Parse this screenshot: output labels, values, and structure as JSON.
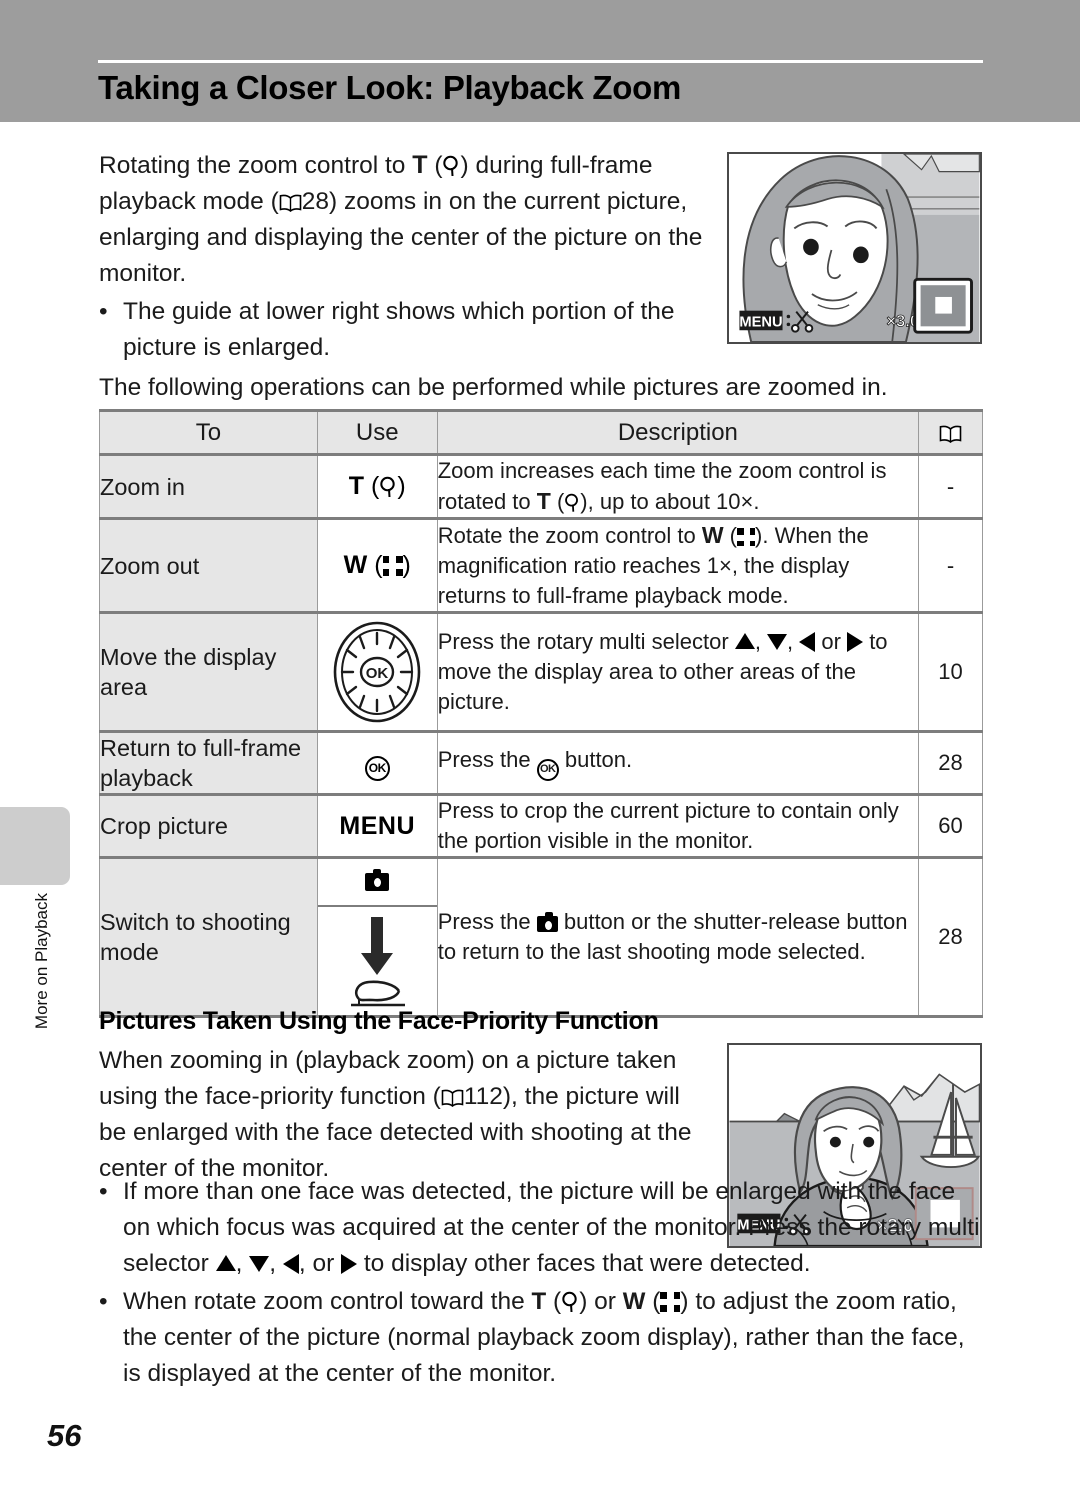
{
  "header": {
    "title": "Taking a Closer Look: Playback Zoom"
  },
  "side_tab": {
    "label": "More on Playback"
  },
  "intro": {
    "para1_a": "Rotating the zoom control to ",
    "para1_T": "T",
    "para1_b": " (",
    "para1_c": ") during full-frame playback mode (",
    "para1_ref": "28",
    "para1_d": ") zooms in on the current picture, enlarging and displaying the center of the picture on the monitor.",
    "bullet1_dot": "•",
    "bullet1": "The guide at lower right shows which portion of the picture is enlarged."
  },
  "following_line": "The following operations can be performed while pictures are zoomed in.",
  "table": {
    "headers": {
      "to": "To",
      "use": "Use",
      "description": "Description",
      "reference": "book-icon"
    },
    "rows": [
      {
        "to": "Zoom in",
        "use_text": "T",
        "use_icon": "magnifier-icon",
        "desc_a": "Zoom increases each time the zoom control is rotated to ",
        "desc_T": "T",
        "desc_b": " (",
        "desc_c": "), up to about 10×.",
        "ref": "-"
      },
      {
        "to": "Zoom out",
        "use_text": "W",
        "use_icon": "thumbnail-icon",
        "desc_a": "Rotate the zoom control to ",
        "desc_W": "W",
        "desc_b": " (",
        "desc_c": "). When the magnification ratio reaches 1×, the display returns to full-frame playback mode.",
        "ref": "-"
      },
      {
        "to": "Move the display area",
        "use_icon": "rotary-multi-selector-icon",
        "desc_a": "Press the rotary multi selector ",
        "desc_b": ", ",
        "desc_c": ", ",
        "desc_d": " or ",
        "desc_e": " to move the display area to other areas of the picture.",
        "ref": "10"
      },
      {
        "to": "Return to full-frame playback",
        "use_icon": "ok-button-icon",
        "use_label": "OK",
        "desc_a": "Press the ",
        "desc_b": " button.",
        "ref": "28"
      },
      {
        "to": "Crop picture",
        "use_text": "MENU",
        "desc_a": "Press to crop the current picture to contain only the portion visible in the monitor.",
        "ref": "60"
      },
      {
        "to": "Switch to shooting mode",
        "use_icon_top": "camera-icon",
        "use_icon_bottom": "shutter-release-icon",
        "desc_a": "Press the ",
        "desc_b": " button or the shutter-release button to return to the last shooting mode selected.",
        "ref": "28"
      }
    ]
  },
  "section2": {
    "heading": "Pictures Taken Using the Face-Priority Function",
    "body_a": "When zooming in (playback zoom) on a picture taken using the face-priority function (",
    "body_ref": "112",
    "body_b": "), the picture will be enlarged with the face detected with shooting at the center of the monitor.",
    "bullet1_dot": "•",
    "bullet1_a": "If more than one face was detected, the picture will be enlarged with the face on which focus was acquired at the center of the monitor. Press the rotary multi selector ",
    "bullet1_b": ", ",
    "bullet1_c": ", ",
    "bullet1_d": ", or ",
    "bullet1_e": " to display other faces that were detected.",
    "bullet2_dot": "•",
    "bullet2_a": "When rotate zoom control toward the ",
    "bullet2_T": "T",
    "bullet2_b": " (",
    "bullet2_c": ") or ",
    "bullet2_W": "W",
    "bullet2_d": " (",
    "bullet2_e": ") to adjust the zoom ratio, the center of the picture (normal playback zoom display), rather than the face, is displayed at the center of the monitor."
  },
  "monitor1": {
    "menu_label": "MENU",
    "crop_icon": "scissors-icon",
    "magnification": "×3.0",
    "guide_icon": "zoom-guide-icon"
  },
  "monitor2": {
    "menu_label": "MENU",
    "crop_icon": "scissors-icon",
    "magnification": "×2.0",
    "guide_icon": "zoom-guide-icon"
  },
  "page_number": "56",
  "colors": {
    "header_band": "#9d9d9d",
    "table_header_bg": "#e6e6e6",
    "table_to_bg": "#e6e6e6",
    "rule": "#7d7d7d",
    "side_tab": "#cdcdcd"
  }
}
